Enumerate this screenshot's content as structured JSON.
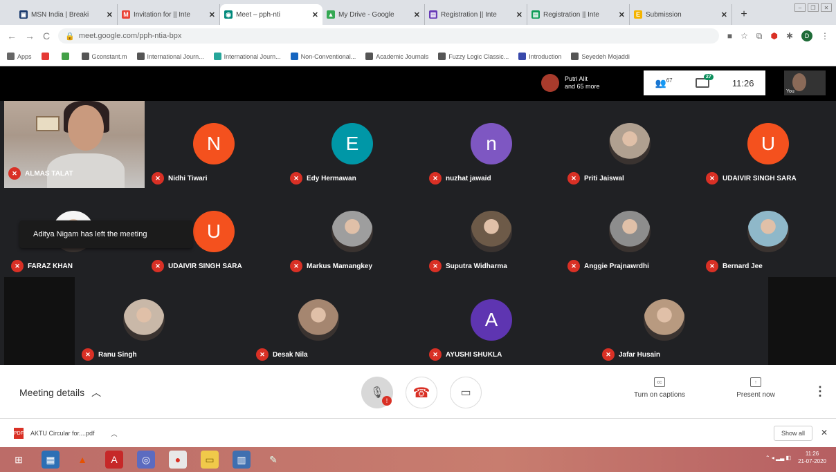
{
  "browser": {
    "tabs": [
      {
        "label": "MSN India | Breaki",
        "color": "#1a3a6e",
        "glyph": "▣",
        "active": false
      },
      {
        "label": "Invitation for || Inte",
        "color": "#ea4335",
        "glyph": "M",
        "active": false
      },
      {
        "label": "Meet – pph-nti",
        "color": "#00897b",
        "glyph": "◉",
        "active": true
      },
      {
        "label": "My Drive - Google",
        "color": "#34a853",
        "glyph": "▲",
        "active": false
      },
      {
        "label": "Registration || Inte",
        "color": "#673ab7",
        "glyph": "▤",
        "active": false
      },
      {
        "label": "Registration || Inte",
        "color": "#0f9d58",
        "glyph": "▤",
        "active": false
      },
      {
        "label": "Submission",
        "color": "#f4b400",
        "glyph": "E",
        "active": false
      }
    ],
    "new_tab": "+",
    "url": "meet.google.com/pph-ntia-bpx",
    "bookmarks": [
      {
        "label": "Apps",
        "color": "#666"
      },
      {
        "label": "",
        "color": "#e53935"
      },
      {
        "label": "",
        "color": "#43a047"
      },
      {
        "label": "Gconstant.m",
        "color": "#555"
      },
      {
        "label": "International Journ...",
        "color": "#555"
      },
      {
        "label": "International Journ...",
        "color": "#26a69a"
      },
      {
        "label": "Non-Conventional...",
        "color": "#1565c0"
      },
      {
        "label": "Academic Journals",
        "color": "#555"
      },
      {
        "label": "Fuzzy Logic Classic...",
        "color": "#555"
      },
      {
        "label": "Introduction",
        "color": "#3949ab"
      },
      {
        "label": "Seyedeh Mojaddi",
        "color": "#555"
      }
    ],
    "profile_initial": "D"
  },
  "meet": {
    "presenter_name": "Putri Alit",
    "presenter_more": "and 65 more",
    "people_count": "67",
    "chat_count": "27",
    "time": "11:26",
    "self_label": "You",
    "participants": [
      {
        "name": "ALMAS TALAT",
        "initial": "",
        "color": "",
        "kind": "video"
      },
      {
        "name": "Nidhi Tiwari",
        "initial": "N",
        "color": "#f4511e",
        "kind": "initial"
      },
      {
        "name": "Edy Hermawan",
        "initial": "E",
        "color": "#0097a7",
        "kind": "initial"
      },
      {
        "name": "nuzhat jawaid",
        "initial": "n",
        "color": "#7e57c2",
        "kind": "initial"
      },
      {
        "name": "Priti Jaiswal",
        "initial": "",
        "color": "#b0a090",
        "kind": "photo"
      },
      {
        "name": "UDAIVIR SINGH SARA",
        "initial": "U",
        "color": "#f4511e",
        "kind": "initial"
      },
      {
        "name": "FARAZ KHAN",
        "initial": "",
        "color": "#f5f5f5",
        "kind": "photo"
      },
      {
        "name": "UDAIVIR SINGH SARA",
        "initial": "U",
        "color": "#f4511e",
        "kind": "initial"
      },
      {
        "name": "Markus Mamangkey",
        "initial": "",
        "color": "#9e9e9e",
        "kind": "photo"
      },
      {
        "name": "Suputra Widharma",
        "initial": "",
        "color": "#6d5a48",
        "kind": "photo"
      },
      {
        "name": "Anggie Prajnawrdhi",
        "initial": "",
        "color": "#8d8d8d",
        "kind": "photo"
      },
      {
        "name": "Bernard Jee",
        "initial": "",
        "color": "#8fb8c9",
        "kind": "photo"
      },
      {
        "name": "Ranu Singh",
        "initial": "",
        "color": "#c9b8a8",
        "kind": "photo"
      },
      {
        "name": "Desak Nila",
        "initial": "",
        "color": "#a58670",
        "kind": "photo"
      },
      {
        "name": "AYUSHI SHUKLA",
        "initial": "A",
        "color": "#5e35b1",
        "kind": "initial"
      },
      {
        "name": "Jafar Husain",
        "initial": "",
        "color": "#b89a80",
        "kind": "photo"
      }
    ],
    "toast": "Aditya Nigam has left the meeting",
    "meeting_details": "Meeting details",
    "captions_label": "Turn on captions",
    "present_label": "Present now"
  },
  "downloads": {
    "file": "AKTU Circular for....pdf",
    "show_all": "Show all"
  },
  "taskbar": {
    "time": "11:26",
    "date": "21-07-2020"
  },
  "colors": {
    "meet_bg": "#202124",
    "mute_red": "#d93025",
    "taskbar": "#c87d6f"
  }
}
